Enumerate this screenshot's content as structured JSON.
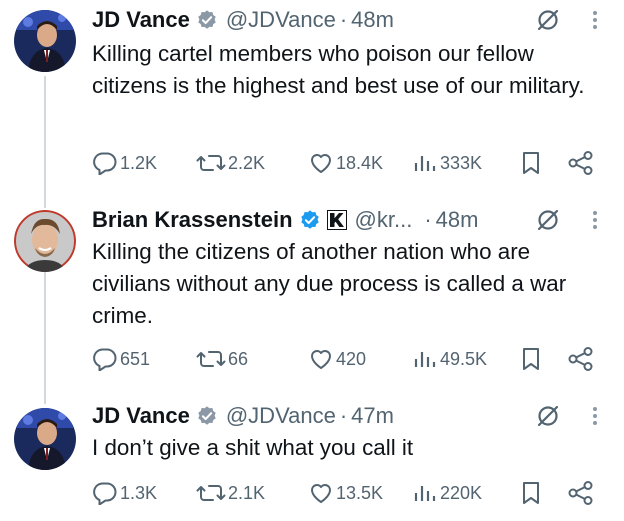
{
  "tweets": [
    {
      "name": "JD Vance",
      "handle": "@JDVance",
      "time": "48m",
      "text": "Killing cartel members who poison our fellow citizens is the highest and best use of our military.",
      "replies": "1.2K",
      "reposts": "2.2K",
      "likes": "18.4K",
      "views": "333K",
      "verified_badge": "gold-check-badge",
      "avatar_icon": "jd-vance-avatar"
    },
    {
      "name": "Brian Krassenstein",
      "handle": "@kr...",
      "time": "48m",
      "text": "Killing the citizens of another nation who are civilians without any due process is called a war crime.",
      "replies": "651",
      "reposts": "66",
      "likes": "420",
      "views": "49.5K",
      "verified_badge": "blue-check-badge",
      "affiliate_badge": "k-logo-badge",
      "avatar_icon": "brian-krassenstein-avatar"
    },
    {
      "name": "JD Vance",
      "handle": "@JDVance",
      "time": "47m",
      "text": "I don’t give a shit what you call it",
      "replies": "1.3K",
      "reposts": "2.1K",
      "likes": "13.5K",
      "views": "220K",
      "verified_badge": "gold-check-badge",
      "avatar_icon": "jd-vance-avatar"
    }
  ],
  "colors": {
    "text": "#0f1419",
    "secondary": "#536471",
    "thread_line": "#cfd9de",
    "gold_badge": "#e2b719",
    "blue_badge": "#1d9bf0"
  },
  "separator": "·"
}
